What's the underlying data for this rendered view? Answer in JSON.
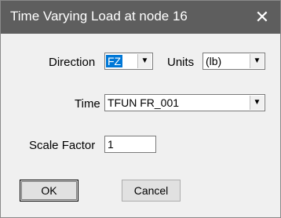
{
  "window": {
    "title": "Time Varying Load at node 16",
    "close_glyph": "✕"
  },
  "form": {
    "direction_label": "Direction",
    "direction_value": "FZ",
    "units_label": "Units",
    "units_value": "(lb)",
    "time_label": "Time",
    "time_value": "TFUN FR_001",
    "scale_label": "Scale Factor",
    "scale_value": "1"
  },
  "buttons": {
    "ok": "OK",
    "cancel": "Cancel"
  },
  "icons": {
    "dropdown": "chevron-down-icon",
    "close": "close-icon"
  }
}
